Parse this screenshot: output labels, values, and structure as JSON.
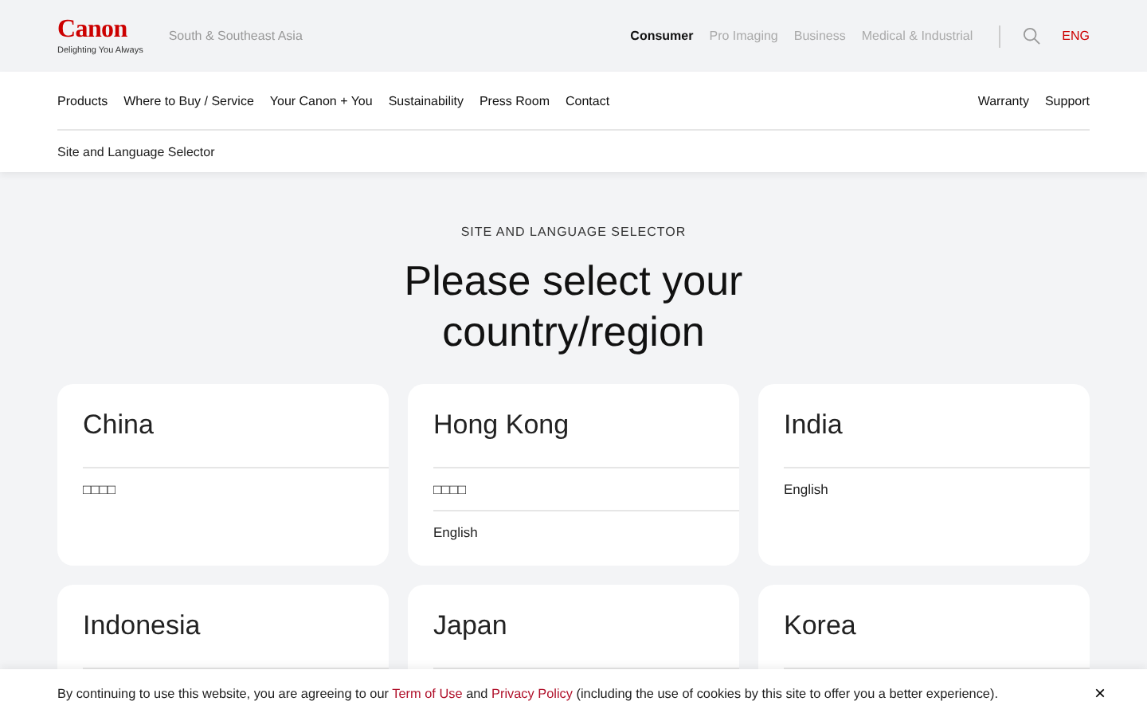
{
  "header": {
    "logo": "Canon",
    "tagline": "Delighting You Always",
    "region": "South & Southeast Asia",
    "segments": [
      {
        "label": "Consumer",
        "selected": true
      },
      {
        "label": "Pro Imaging",
        "selected": false
      },
      {
        "label": "Business",
        "selected": false
      },
      {
        "label": "Medical & Industrial",
        "selected": false
      }
    ],
    "language": "ENG"
  },
  "nav": {
    "items": [
      "Products",
      "Where to Buy / Service",
      "Your Canon + You",
      "Sustainability",
      "Press Room",
      "Contact"
    ],
    "right_items": [
      "Warranty",
      "Support"
    ],
    "breadcrumb": "Site and Language Selector"
  },
  "main": {
    "eyebrow": "SITE AND LANGUAGE SELECTOR",
    "heading": "Please select your country/region",
    "countries": [
      {
        "name": "China",
        "languages": [
          "□□□□"
        ]
      },
      {
        "name": "Hong Kong",
        "languages": [
          "□□□□",
          "English"
        ]
      },
      {
        "name": "India",
        "languages": [
          "English"
        ]
      },
      {
        "name": "Indonesia"
      },
      {
        "name": "Japan"
      },
      {
        "name": "Korea"
      }
    ]
  },
  "cookie_bar": {
    "before": "By continuing to use this website, you are agreeing to our",
    "terms_link": "Term of Use",
    "middle": "and",
    "privacy_link": "Privacy Policy",
    "after": "(including the use of cookies by this site to offer you a better experience).",
    "close": "×"
  }
}
